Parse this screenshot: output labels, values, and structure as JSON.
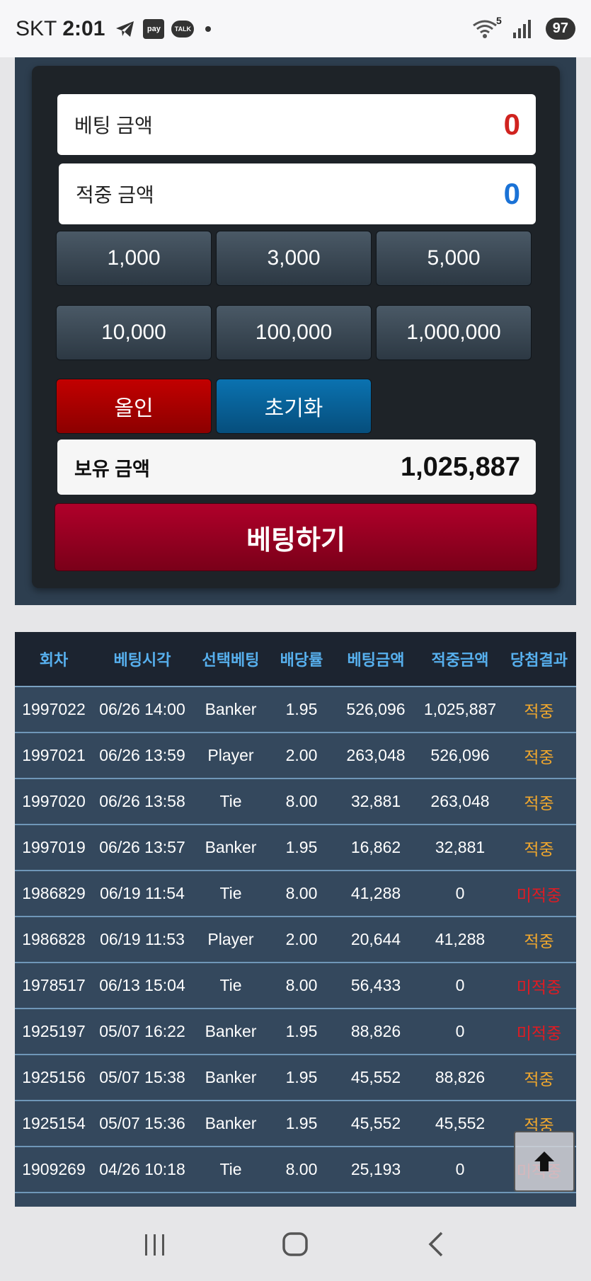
{
  "status_bar": {
    "carrier": "SKT",
    "time": "2:01",
    "pay_label": "pay",
    "talk_label": "TALK",
    "wifi_label": "5",
    "battery": "97"
  },
  "bet_panel": {
    "bet_amount_label": "베팅 금액",
    "bet_amount_value": "0",
    "win_amount_label": "적중 금액",
    "win_amount_value": "0",
    "chips": [
      "1,000",
      "3,000",
      "5,000",
      "10,000",
      "100,000",
      "1,000,000"
    ],
    "allin_label": "올인",
    "reset_label": "초기화",
    "balance_label": "보유 금액",
    "balance_value": "1,025,887",
    "bet_button_label": "베팅하기",
    "colors": {
      "bet_value": "#d0231f",
      "win_value": "#1a72d6",
      "allin": "#b00000",
      "reset": "#0a6aa6",
      "bet_button": "#9a0022"
    }
  },
  "history": {
    "headers": [
      "회차",
      "베팅시각",
      "선택베팅",
      "배당률",
      "베팅금액",
      "적중금액",
      "당첨결과"
    ],
    "rows": [
      [
        "1997022",
        "06/26 14:00",
        "Banker",
        "1.95",
        "526,096",
        "1,025,887",
        "적중"
      ],
      [
        "1997021",
        "06/26 13:59",
        "Player",
        "2.00",
        "263,048",
        "526,096",
        "적중"
      ],
      [
        "1997020",
        "06/26 13:58",
        "Tie",
        "8.00",
        "32,881",
        "263,048",
        "적중"
      ],
      [
        "1997019",
        "06/26 13:57",
        "Banker",
        "1.95",
        "16,862",
        "32,881",
        "적중"
      ],
      [
        "1986829",
        "06/19 11:54",
        "Tie",
        "8.00",
        "41,288",
        "0",
        "미적중"
      ],
      [
        "1986828",
        "06/19 11:53",
        "Player",
        "2.00",
        "20,644",
        "41,288",
        "적중"
      ],
      [
        "1978517",
        "06/13 15:04",
        "Tie",
        "8.00",
        "56,433",
        "0",
        "미적중"
      ],
      [
        "1925197",
        "05/07 16:22",
        "Banker",
        "1.95",
        "88,826",
        "0",
        "미적중"
      ],
      [
        "1925156",
        "05/07 15:38",
        "Banker",
        "1.95",
        "45,552",
        "88,826",
        "적중"
      ],
      [
        "1925154",
        "05/07 15:36",
        "Banker",
        "1.95",
        "45,552",
        "45,552",
        "적중"
      ],
      [
        "1909269",
        "04/26 10:18",
        "Tie",
        "8.00",
        "25,193",
        "0",
        "미적중"
      ]
    ],
    "colors": {
      "header_text": "#57b0ee",
      "hit": "#f0a72d",
      "miss": "#e01b22"
    }
  },
  "scroll_top_icon": "arrow-up-icon",
  "nav": {
    "recent_icon": "recent-apps-icon",
    "home_icon": "home-icon",
    "back_icon": "back-icon"
  }
}
